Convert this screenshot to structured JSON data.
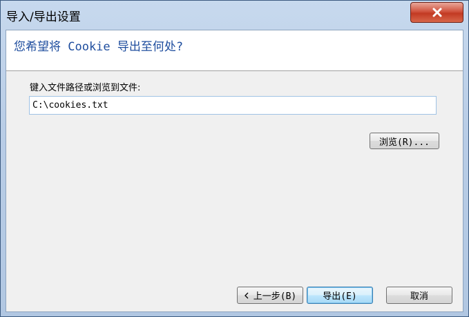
{
  "window": {
    "title": "导入/导出设置",
    "close_glyph": "✕"
  },
  "header": {
    "heading": "您希望将 Cookie 导出至何处?"
  },
  "form": {
    "label": "键入文件路径或浏览到文件:",
    "path_value": "C:\\cookies.txt",
    "browse_label": "浏览(R)..."
  },
  "footer": {
    "back_label": "上一步(B)",
    "export_label": "导出(E)",
    "cancel_label": "取消"
  },
  "colors": {
    "heading": "#1e4d9e",
    "close_button": "#c23a23",
    "panel": "#f0f0f0"
  }
}
